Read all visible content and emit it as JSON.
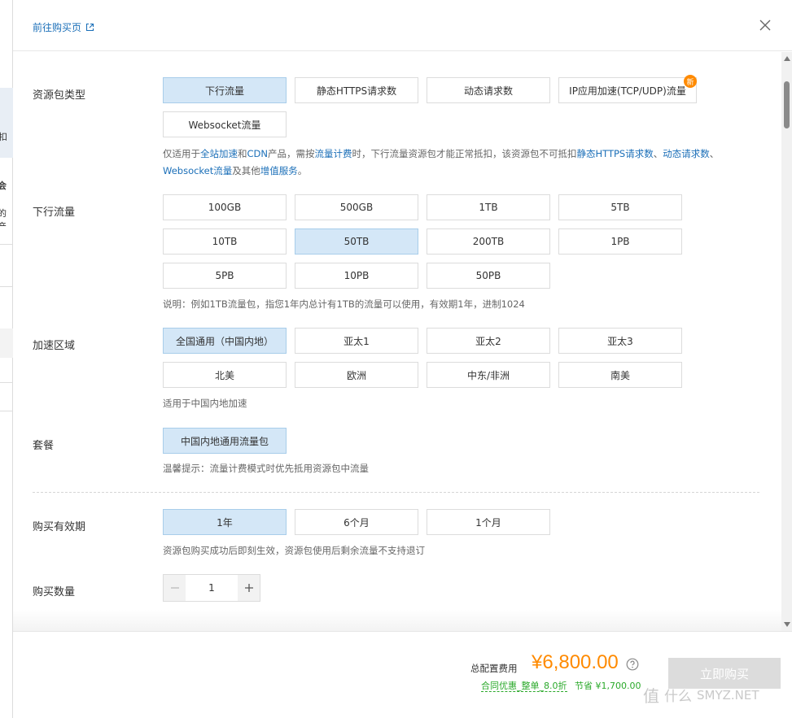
{
  "top": {
    "buy_link": "前往购买页"
  },
  "sections": {
    "package_type": {
      "label": "资源包类型",
      "options": [
        "下行流量",
        "静态HTTPS请求数",
        "动态请求数",
        "IP应用加速(TCP/UDP)流量",
        "Websocket流量"
      ],
      "new_badge": "新",
      "note": {
        "p1": "仅适用于",
        "l1": "全站加速",
        "p2": "和",
        "l2": "CDN",
        "p3": "产品，需按",
        "l3": "流量计费",
        "p4": "时，下行流量资源包才能正常抵扣，该资源包不可抵扣",
        "l4": "静态HTTPS请求数",
        "p5": "、",
        "l5": "动态请求数",
        "p6": "、",
        "l6": "Websocket流量",
        "p7": "及其他",
        "l7": "增值服务",
        "p8": "。"
      }
    },
    "traffic": {
      "label": "下行流量",
      "options": [
        "100GB",
        "500GB",
        "1TB",
        "5TB",
        "10TB",
        "50TB",
        "200TB",
        "1PB",
        "5PB",
        "10PB",
        "50PB"
      ],
      "note": "说明：例如1TB流量包，指您1年内总计有1TB的流量可以使用，有效期1年，进制1024"
    },
    "region": {
      "label": "加速区域",
      "options": [
        "全国通用（中国内地）",
        "亚太1",
        "亚太2",
        "亚太3",
        "北美",
        "欧洲",
        "中东/非洲",
        "南美"
      ],
      "note": "适用于中国内地加速"
    },
    "plan": {
      "label": "套餐",
      "options": [
        "中国内地通用流量包"
      ],
      "note": "温馨提示：流量计费模式时优先抵用资源包中流量"
    },
    "period": {
      "label": "购买有效期",
      "options": [
        "1年",
        "6个月",
        "1个月"
      ],
      "note": "资源包购买成功后即刻生效，资源包使用后剩余流量不支持退订"
    },
    "quantity": {
      "label": "购买数量",
      "value": "1"
    }
  },
  "footer": {
    "total_label": "总配置费用",
    "price": "¥6,800.00",
    "discount": "合同优惠_整单_8.0折",
    "saving": "节省 ¥1,700.00",
    "buy_button": "立即购买"
  },
  "watermark": {
    "text": "SMYZ.NET",
    "glyph": "值",
    "suffix": "什么"
  },
  "background_fragments": [
    "扣",
    "会",
    "的",
    "产"
  ],
  "colors": {
    "accent": "#1b6fb8",
    "selected_bg": "#d4e7f7",
    "price": "#ff8a00",
    "discount": "#2aa92a",
    "badge": "#ff8a00"
  }
}
